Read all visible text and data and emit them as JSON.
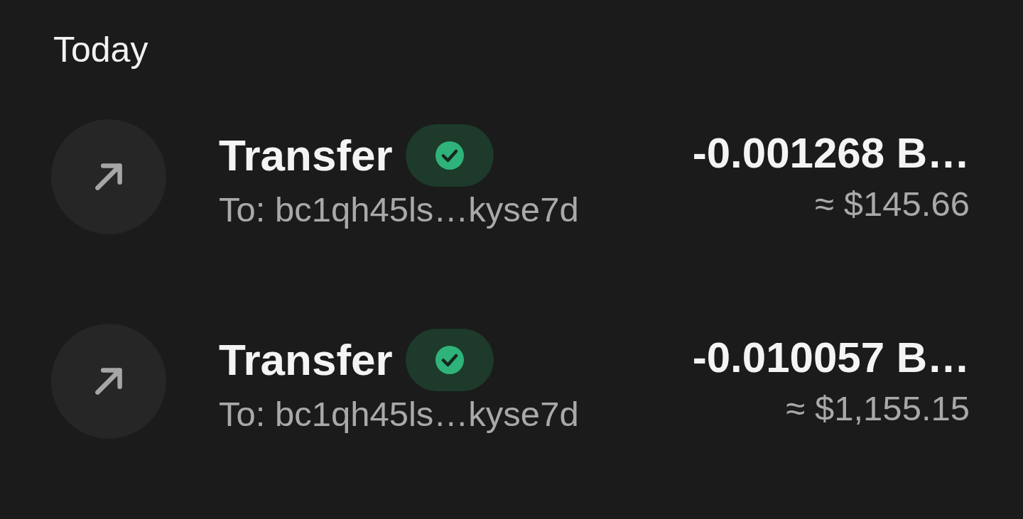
{
  "section_title": "Today",
  "transactions": [
    {
      "kind": "outgoing",
      "title": "Transfer",
      "confirmed": true,
      "subtitle": "To: bc1qh45ls…kyse7d",
      "amount": "-0.001268 B…",
      "fiat": "≈ $145.66"
    },
    {
      "kind": "outgoing",
      "title": "Transfer",
      "confirmed": true,
      "subtitle": "To: bc1qh45ls…kyse7d",
      "amount": "-0.010057 B…",
      "fiat": "≈ $1,155.15"
    }
  ]
}
